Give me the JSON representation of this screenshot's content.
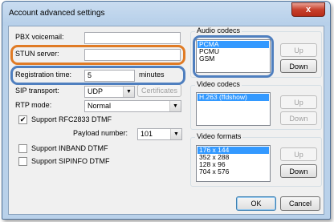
{
  "window": {
    "title": "Account advanced settings",
    "close_glyph": "x"
  },
  "form": {
    "pbx_voicemail_label": "PBX voicemail:",
    "pbx_voicemail_value": "",
    "stun_server_label": "STUN server:",
    "stun_server_value": "",
    "registration_time_label": "Registration time:",
    "registration_time_value": "5",
    "registration_time_unit": "minutes",
    "sip_transport_label": "SIP transport:",
    "sip_transport_value": "UDP",
    "certificates_label": "Certificates",
    "rtp_mode_label": "RTP mode:",
    "rtp_mode_value": "Normal",
    "rfc2833_label": "Support RFC2833 DTMF",
    "rfc2833_checked": true,
    "payload_label": "Payload number:",
    "payload_value": "101",
    "inband_label": "Support INBAND DTMF",
    "inband_checked": false,
    "sipinfo_label": "Support SIPINFO DTMF",
    "sipinfo_checked": false
  },
  "audio_codecs": {
    "title": "Audio codecs",
    "items": [
      "PCMA",
      "PCMU",
      "GSM"
    ],
    "selected": "PCMA",
    "up_label": "Up",
    "down_label": "Down"
  },
  "video_codecs": {
    "title": "Video codecs",
    "items": [
      "H.263 (ffdshow)"
    ],
    "selected": "H.263 (ffdshow)",
    "up_label": "Up",
    "down_label": "Down"
  },
  "video_formats": {
    "title": "Video formats",
    "items": [
      "176 x 144",
      "352 x 288",
      "128 x 96",
      "704 x 576"
    ],
    "selected": "176 x 144",
    "up_label": "Up",
    "down_label": "Down"
  },
  "footer": {
    "ok_label": "OK",
    "cancel_label": "Cancel"
  },
  "colors": {
    "highlight_orange": "#e07b25",
    "highlight_blue": "#4f7fbf",
    "selection": "#3399ff"
  }
}
